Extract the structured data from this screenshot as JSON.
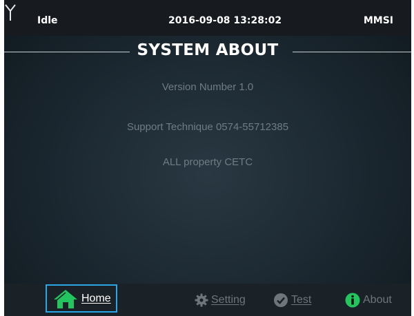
{
  "status": {
    "state": "Idle",
    "datetime": "2016-09-08 13:28:02",
    "mmsi_label": "MMSI"
  },
  "page": {
    "title": "SYSTEM ABOUT"
  },
  "info": {
    "version": "Version Number  1.0",
    "support": "Support Technique 0574-55712385",
    "property": "ALL property   CETC"
  },
  "nav": {
    "home": "Home",
    "setting": "Setting",
    "test": "Test",
    "about": "About",
    "selected": "home"
  },
  "colors": {
    "home_icon": "#22c55e",
    "about_icon": "#22c55e",
    "selection_border": "#2aa7e8"
  },
  "icons": [
    "antenna-icon",
    "home-icon",
    "gear-icon",
    "check-icon",
    "info-icon"
  ]
}
